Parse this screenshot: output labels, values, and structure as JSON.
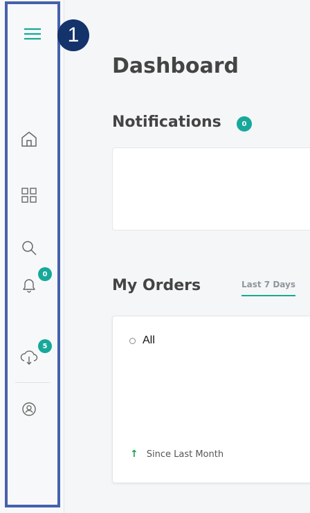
{
  "sidebar": {
    "callout_number": "1",
    "items": [
      {
        "name": "home",
        "icon": "home-icon"
      },
      {
        "name": "apps",
        "icon": "grid-icon"
      },
      {
        "name": "search",
        "icon": "search-icon"
      },
      {
        "name": "notifications",
        "icon": "bell-icon",
        "badge": "0"
      },
      {
        "name": "downloads",
        "icon": "cloud-download-icon",
        "badge": "5"
      },
      {
        "name": "profile",
        "icon": "user-circle-icon"
      }
    ]
  },
  "main": {
    "title": "Dashboard",
    "notifications": {
      "title": "Notifications",
      "count": "0"
    },
    "orders": {
      "title": "My Orders",
      "tab_label": "Last 7 Days",
      "filter_label": "All",
      "since_label": "Since Last Month"
    }
  },
  "colors": {
    "accent": "#17a89a",
    "highlight_frame": "#4561ad",
    "callout_bg": "#14336a",
    "trend_up": "#1aa24c"
  }
}
